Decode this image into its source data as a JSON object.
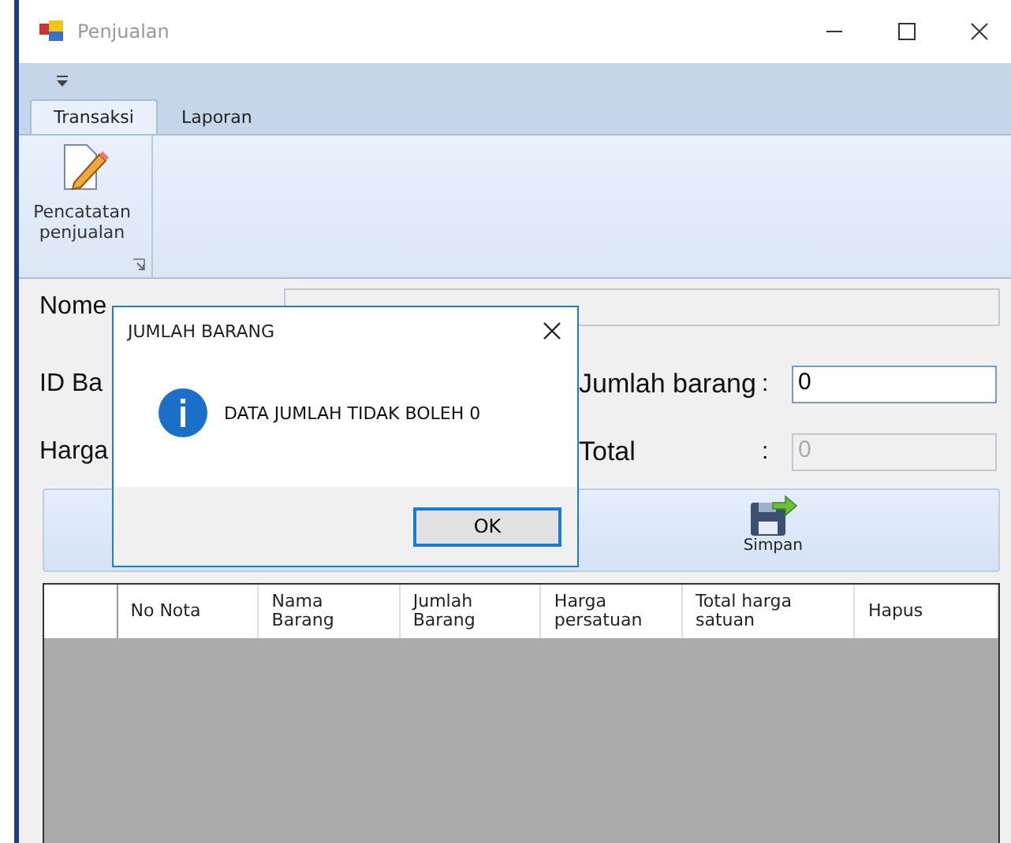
{
  "window": {
    "title": "Penjualan"
  },
  "ribbon": {
    "tabs": [
      {
        "label": "Transaksi",
        "selected": true
      },
      {
        "label": "Laporan",
        "selected": false
      }
    ],
    "group": {
      "button": "Pencatatan penjualan"
    }
  },
  "form": {
    "rows": [
      {
        "label": "Nome",
        "disabled": true
      },
      {
        "label": "ID Ba",
        "right_label": "Jumlah barang",
        "right_colon": ":",
        "right_value": "0",
        "right_disabled": false
      },
      {
        "label": "Harga",
        "right_label": "Total",
        "right_colon": ":",
        "right_value": "0",
        "right_disabled": true
      }
    ],
    "save_button": "Simpan"
  },
  "table": {
    "columns": [
      "No Nota",
      "Nama Barang",
      "Jumlah Barang",
      "Harga persatuan",
      "Total harga satuan",
      "Hapus"
    ]
  },
  "dialog": {
    "title": "JUMLAH BARANG",
    "message": "DATA JUMLAH TIDAK BOLEH 0",
    "button": "OK"
  }
}
